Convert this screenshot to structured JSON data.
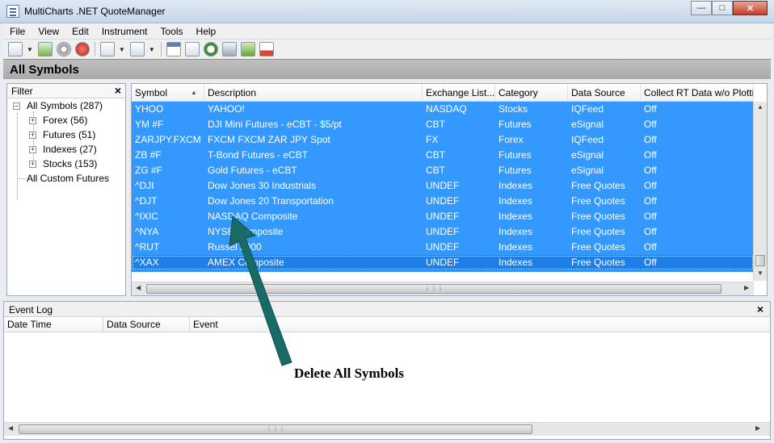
{
  "window": {
    "title": "MultiCharts .NET QuoteManager"
  },
  "menu": [
    "File",
    "View",
    "Edit",
    "Instrument",
    "Tools",
    "Help"
  ],
  "toolbar": {
    "icons": [
      "new-symbol-icon",
      "add-symbol-icon",
      "settings-gear-icon",
      "delete-stop-icon",
      "import-icon",
      "export-icon",
      "calendar-icon",
      "data-window-icon",
      "clock-icon",
      "exchange-bank-icon",
      "document-icon",
      "chart-icon"
    ]
  },
  "header": {
    "title": "All Symbols"
  },
  "filter": {
    "title": "Filter",
    "tree": {
      "root": "All Symbols (287)",
      "children": [
        "Forex (56)",
        "Futures (51)",
        "Indexes (27)",
        "Stocks (153)"
      ],
      "extra": "All Custom Futures"
    }
  },
  "grid": {
    "columns": [
      "Symbol",
      "Description",
      "Exchange List...",
      "Category",
      "Data Source",
      "Collect RT Data w/o Plotti"
    ],
    "rows": [
      [
        "YHOO",
        "YAHOO!",
        "NASDAQ",
        "Stocks",
        "IQFeed",
        "Off"
      ],
      [
        "YM #F",
        "DJI Mini Futures - eCBT - $5/pt",
        "CBT",
        "Futures",
        "eSignal",
        "Off"
      ],
      [
        "ZARJPY.FXCM",
        "FXCM FXCM ZAR JPY Spot",
        "FX",
        "Forex",
        "IQFeed",
        "Off"
      ],
      [
        "ZB #F",
        "T-Bond Futures - eCBT",
        "CBT",
        "Futures",
        "eSignal",
        "Off"
      ],
      [
        "ZG #F",
        "Gold Futures - eCBT",
        "CBT",
        "Futures",
        "eSignal",
        "Off"
      ],
      [
        "^DJI",
        "Dow Jones 30 Industrials",
        "UNDEF",
        "Indexes",
        "Free Quotes",
        "Off"
      ],
      [
        "^DJT",
        "Dow Jones 20 Transportation",
        "UNDEF",
        "Indexes",
        "Free Quotes",
        "Off"
      ],
      [
        "^IXIC",
        "NASDAQ Composite",
        "UNDEF",
        "Indexes",
        "Free Quotes",
        "Off"
      ],
      [
        "^NYA",
        "NYSE Composite",
        "UNDEF",
        "Indexes",
        "Free Quotes",
        "Off"
      ],
      [
        "^RUT",
        "Russel 2000",
        "UNDEF",
        "Indexes",
        "Free Quotes",
        "Off"
      ],
      [
        "^XAX",
        "AMEX Composite",
        "UNDEF",
        "Indexes",
        "Free Quotes",
        "Off"
      ]
    ]
  },
  "eventlog": {
    "title": "Event Log",
    "columns": [
      "Date Time",
      "Data Source",
      "Event"
    ]
  },
  "annotation": {
    "text": "Delete All Symbols",
    "color": "#1a6b66"
  },
  "colors": {
    "selection": "#3399ff",
    "header_bar": "#b0b0b0"
  }
}
